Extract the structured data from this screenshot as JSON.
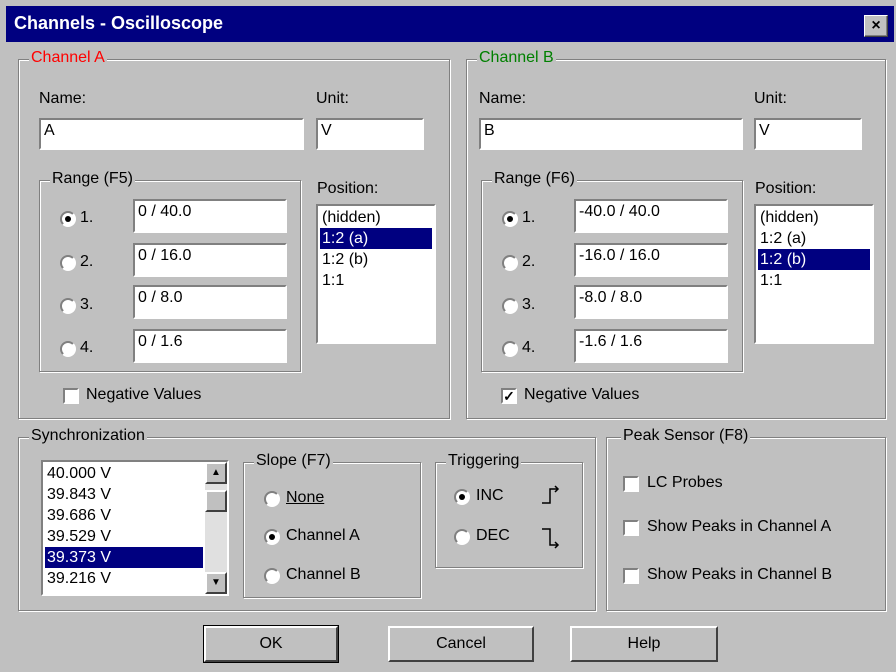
{
  "window": {
    "title": "Channels - Oscilloscope",
    "close_glyph": "×"
  },
  "channel_a": {
    "legend": "Channel A",
    "color": "#ff0000",
    "name_label": "Name:",
    "name_value": "A",
    "unit_label": "Unit:",
    "unit_value": "V",
    "range_legend": "Range (F5)",
    "ranges": [
      {
        "label": "1.",
        "value": "0 / 40.0",
        "selected": true
      },
      {
        "label": "2.",
        "value": "0 / 16.0",
        "selected": false
      },
      {
        "label": "3.",
        "value": "0 / 8.0",
        "selected": false
      },
      {
        "label": "4.",
        "value": "0 / 1.6",
        "selected": false
      }
    ],
    "position_label": "Position:",
    "positions": [
      "(hidden)",
      "1:2 (a)",
      "1:2 (b)",
      "1:1"
    ],
    "position_selected": "1:2 (a)",
    "negative_label": "Negative Values",
    "negative_checked": false
  },
  "channel_b": {
    "legend": "Channel B",
    "color": "#008000",
    "name_label": "Name:",
    "name_value": "B",
    "unit_label": "Unit:",
    "unit_value": "V",
    "range_legend": "Range (F6)",
    "ranges": [
      {
        "label": "1.",
        "value": "-40.0 / 40.0",
        "selected": true
      },
      {
        "label": "2.",
        "value": "-16.0 / 16.0",
        "selected": false
      },
      {
        "label": "3.",
        "value": "-8.0 / 8.0",
        "selected": false
      },
      {
        "label": "4.",
        "value": "-1.6 / 1.6",
        "selected": false
      }
    ],
    "position_label": "Position:",
    "positions": [
      "(hidden)",
      "1:2 (a)",
      "1:2 (b)",
      "1:1"
    ],
    "position_selected": "1:2 (b)",
    "negative_label": "Negative Values",
    "negative_checked": true
  },
  "synchronization": {
    "legend": "Synchronization",
    "levels": [
      "40.000 V",
      "39.843 V",
      "39.686 V",
      "39.529 V",
      "39.373 V",
      "39.216 V"
    ],
    "selected_level": "39.373 V",
    "slope_legend": "Slope (F7)",
    "slope_options": [
      {
        "label": "None",
        "selected": false
      },
      {
        "label": "Channel A",
        "selected": true
      },
      {
        "label": "Channel B",
        "selected": false
      }
    ],
    "triggering_legend": "Triggering",
    "trigger_options": [
      {
        "label": "INC",
        "selected": true,
        "icon": "rising-edge-icon"
      },
      {
        "label": "DEC",
        "selected": false,
        "icon": "falling-edge-icon"
      }
    ]
  },
  "peak_sensor": {
    "legend": "Peak Sensor (F8)",
    "options": [
      {
        "label": "LC Probes",
        "checked": false
      },
      {
        "label": "Show Peaks in Channel A",
        "checked": false
      },
      {
        "label": "Show Peaks in Channel B",
        "checked": false
      }
    ]
  },
  "buttons": {
    "ok": "OK",
    "cancel": "Cancel",
    "help": "Help"
  }
}
